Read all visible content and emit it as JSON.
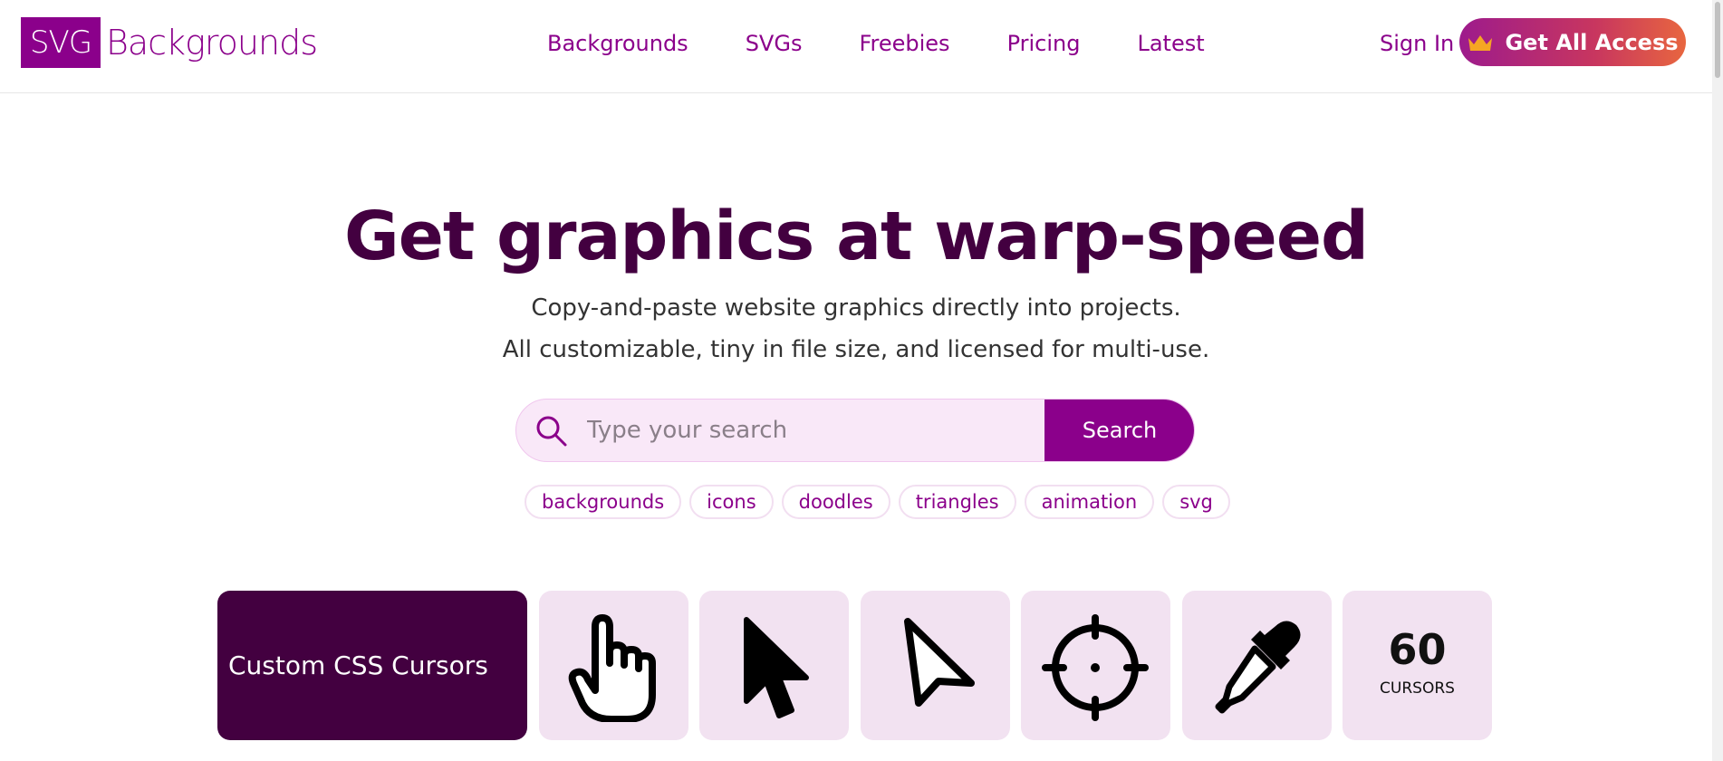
{
  "header": {
    "logo_box": "SVG",
    "logo_text": "Backgrounds",
    "nav": [
      "Backgrounds",
      "SVGs",
      "Freebies",
      "Pricing",
      "Latest"
    ],
    "sign_in": "Sign In",
    "cta": "Get All Access",
    "cta_icon": "crown-icon"
  },
  "hero": {
    "title": "Get graphics at warp-speed",
    "subtitle_1": "Copy-and-paste website graphics directly into projects.",
    "subtitle_2": "All customizable, tiny in file size, and licensed for multi-use."
  },
  "search": {
    "placeholder": "Type your search",
    "button": "Search",
    "icon": "search-icon",
    "tags": [
      "backgrounds",
      "icons",
      "doodles",
      "triangles",
      "animation",
      "svg"
    ]
  },
  "collection": {
    "title": "Custom CSS Cursors",
    "icons": [
      "pointing-hand-cursor-icon",
      "arrow-cursor-icon",
      "outline-arrow-cursor-icon",
      "crosshair-cursor-icon",
      "eyedropper-cursor-icon"
    ],
    "count": "60",
    "count_label": "CURSORS"
  },
  "colors": {
    "brand": "#8b008b",
    "title": "#430040",
    "card_bg": "#f2e2f1"
  }
}
